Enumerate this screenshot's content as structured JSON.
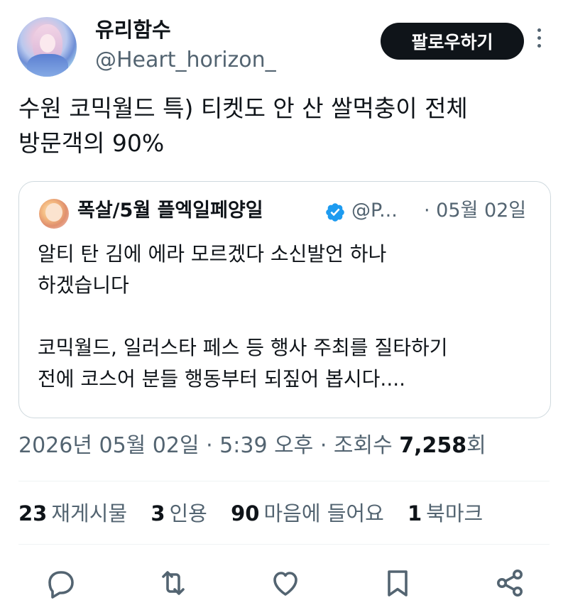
{
  "author": {
    "name": "유리함수",
    "handle": "@Heart_horizon_"
  },
  "follow_label": "팔로우하기",
  "tweet": {
    "lines": [
      "수원 코믹월드 특) 티켓도 안 산 쌀먹충이 전체",
      "방문객의 90%"
    ]
  },
  "quote": {
    "name": "폭살/5월 플엑일페양일",
    "handle": "@P...",
    "date": "· 05월 02일",
    "lines": [
      "알티 탄 김에 에라 모르겠다 소신발언 하나",
      "하겠습니다",
      "",
      "코믹월드, 일러스타 페스 등 행사 주최를 질타하기",
      "전에 코스어 분들 행동부터 되짚어 봅시다...."
    ]
  },
  "meta": {
    "text": "2026년 05월 02일 · 5:39 오후 · 조회수 ",
    "views": "7,258",
    "views_suffix": "회"
  },
  "stats": {
    "reposts_num": "23",
    "reposts_label": "재게시물",
    "quotes_num": "3",
    "quotes_label": "인용",
    "likes_num": "90",
    "likes_label": "마음에 들어요",
    "bookmarks_num": "1",
    "bookmarks_label": "북마크"
  },
  "icons": {
    "reply": "reply-icon",
    "repost": "repost-icon",
    "like": "heart-icon",
    "bookmark": "bookmark-icon",
    "share": "share-icon"
  },
  "colors": {
    "text": "#0f1419",
    "secondary": "#536471",
    "verified": "#1d9bf0",
    "border": "#cfd9de"
  }
}
